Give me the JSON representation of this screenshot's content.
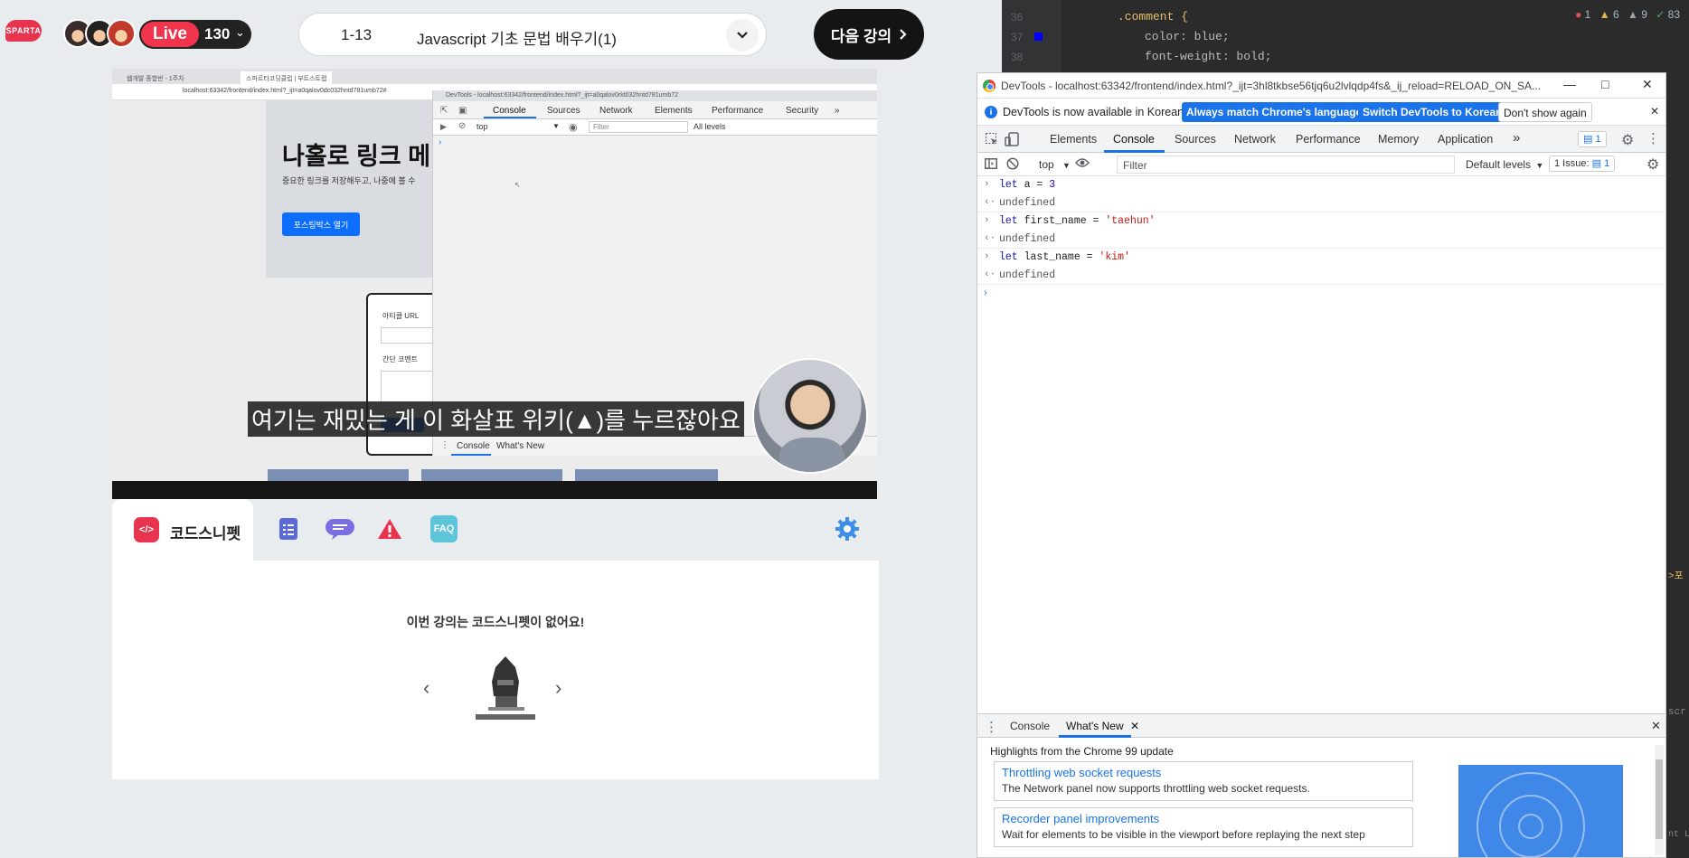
{
  "header": {
    "logo_text": "SPARTA",
    "live_label": "Live",
    "viewer_count": "130",
    "lesson_number": "1-13",
    "lesson_title": "Javascript 기초 문법 배우기(1)",
    "next_button": "다음 강의"
  },
  "video": {
    "browser_tabs": [
      "웹개발 종합반 - 1주차",
      "스파르타코딩클럽 | 부트스트랩"
    ],
    "address": "localhost:63342/frontend/index.html?_ijt=a0qalov0dc032hntd781umb72#",
    "hero_title": "나홀로 링크 메",
    "hero_subtitle": "중요한 링크를 저장해두고, 나중에 볼 수",
    "hero_button": "포스팅박스 열기",
    "form_url_label": "아티클 URL",
    "form_comment_label": "간단 코멘트",
    "devtools_title": "DevTools - localhost:63342/frontend/index.html?_ijt=a0qalov0rkt032hntd781umb72",
    "devtools_tabs": [
      "Console",
      "Sources",
      "Network",
      "Elements",
      "Performance",
      "Security"
    ],
    "devtools_context": "top",
    "devtools_filter": "Filter",
    "devtools_levels": "All levels",
    "devtools_drawer_tabs": [
      "Console",
      "What's New"
    ],
    "subtitle": "여기는 재밌는 게 이 화살표 위키(▲)를 누르잖아요"
  },
  "snippets": {
    "tab_label": "코드스니펫",
    "tab_icon": "</>",
    "faq_label": "FAQ",
    "empty_message": "이번 강의는 코드스니펫이 없어요!"
  },
  "ide": {
    "lines": [
      {
        "num": "36",
        "code": ".comment {"
      },
      {
        "num": "37",
        "code": "color: blue;"
      },
      {
        "num": "38",
        "code": "font-weight: bold;"
      }
    ],
    "status": {
      "errors": "1",
      "warnings": "6",
      "weak_warnings": "9",
      "ok": "83"
    },
    "side_text": ">포",
    "side_text2": "scr",
    "side_text3": "nt Lo"
  },
  "devtools": {
    "window_title": "DevTools - localhost:63342/frontend/index.html?_ijt=3hl8tkbse56tjq6u2lvlqdp4fs&_ij_reload=RELOAD_ON_SA...",
    "info_text": "DevTools is now available in Korean!",
    "info_btn_match": "Always match Chrome's language",
    "info_btn_switch": "Switch DevTools to Korean",
    "info_btn_dont": "Don't show again",
    "tabs": [
      "Elements",
      "Console",
      "Sources",
      "Network",
      "Performance",
      "Memory",
      "Application"
    ],
    "messages_badge": "1",
    "context": "top",
    "filter_placeholder": "Filter",
    "levels": "Default levels",
    "issues_label": "1 Issue:",
    "issues_count": "1",
    "console": [
      {
        "type": "in",
        "kw": "let",
        "rest": " a = ",
        "val": "3",
        "val_type": "num"
      },
      {
        "type": "out",
        "text": "undefined"
      },
      {
        "type": "in",
        "kw": "let",
        "rest": " first_name = ",
        "val": "'taehun'",
        "val_type": "str"
      },
      {
        "type": "out",
        "text": "undefined"
      },
      {
        "type": "in",
        "kw": "let",
        "rest": " last_name = ",
        "val": "'kim'",
        "val_type": "str"
      },
      {
        "type": "out",
        "text": "undefined"
      }
    ],
    "drawer": {
      "tabs": [
        "Console",
        "What's New"
      ],
      "headline": "Highlights from the Chrome 99 update",
      "items": [
        {
          "title": "Throttling web socket requests",
          "desc": "The Network panel now supports throttling web socket requests."
        },
        {
          "title": "Recorder panel improvements",
          "desc": "Wait for elements to be visible in the viewport before replaying the next step"
        }
      ]
    }
  },
  "colors": {
    "brand": "#e8344e",
    "devtools_blue": "#1a73e8",
    "ide_bg": "#2b2b2b"
  }
}
